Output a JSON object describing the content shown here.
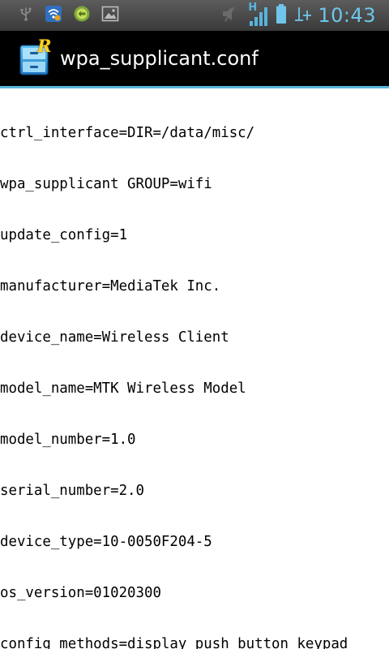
{
  "status_bar": {
    "time": "10:43",
    "left_icons": [
      "usb-icon",
      "wifi-sync-icon",
      "app-notification-icon",
      "gallery-icon"
    ],
    "right_icons": [
      "mute-icon",
      "hspa-signal-icon",
      "battery-icon",
      "data-transfer-icon"
    ],
    "network_type": "H",
    "accent_color": "#6fc6ea"
  },
  "title_bar": {
    "title": "wpa_supplicant.conf",
    "icon": "root-explorer-icon",
    "icon_letter": "R",
    "accent_color": "#58b4dc"
  },
  "file_content": {
    "lines": [
      "ctrl_interface=DIR=/data/misc/",
      "wpa_supplicant GROUP=wifi",
      "update_config=1",
      "manufacturer=MediaTek Inc.",
      "device_name=Wireless Client",
      "model_name=MTK Wireless Model",
      "model_number=1.0",
      "serial_number=2.0",
      "device_type=10-0050F204-5",
      "os_version=01020300",
      "config_methods=display push_button keypad"
    ]
  }
}
